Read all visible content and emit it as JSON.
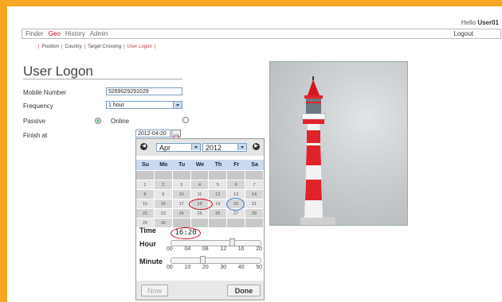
{
  "header": {
    "hello_prefix": "Hello ",
    "user": "User01"
  },
  "nav": {
    "items": [
      {
        "label": "Finder",
        "active": false
      },
      {
        "label": "Geo",
        "active": true
      },
      {
        "label": "History",
        "active": false
      },
      {
        "label": "Admin",
        "active": false
      }
    ],
    "logout": "Logout"
  },
  "subnav": {
    "items": [
      {
        "label": "Position",
        "active": false
      },
      {
        "label": "Country",
        "active": false
      },
      {
        "label": "Target Crossing",
        "active": false
      },
      {
        "label": "User Logon",
        "active": true
      }
    ],
    "sep": "|"
  },
  "form": {
    "title": "User Logon",
    "mobile_label": "Mobile Number",
    "mobile_value": "5269029291029",
    "frequency_label": "Frequency",
    "frequency_value": "1 hour",
    "mode_label": "Passive",
    "mode_option": "Online",
    "finish_label": "Finish at",
    "finish_value": "2012-04-20"
  },
  "datepicker": {
    "month": "Apr",
    "year": "2012",
    "dows": [
      "Su",
      "Mo",
      "Tu",
      "We",
      "Th",
      "Fr",
      "Sa"
    ],
    "weeks": [
      [
        "",
        "",
        "",
        "",
        "",
        "",
        ""
      ],
      [
        "1",
        "2",
        "3",
        "4",
        "5",
        "6",
        "7"
      ],
      [
        "8",
        "9",
        "10",
        "11",
        "12",
        "13",
        "14"
      ],
      [
        "15",
        "16",
        "17",
        "18",
        "19",
        "20",
        "21"
      ],
      [
        "22",
        "23",
        "24",
        "25",
        "26",
        "27",
        "28"
      ],
      [
        "29",
        "30",
        "",
        "",
        "",
        "",
        ""
      ]
    ],
    "today": "18",
    "selected": "20",
    "time_label": "Time",
    "time_value": "16:20",
    "hour_label": "Hour",
    "hour_value": 16,
    "hour_ticks": [
      "00",
      "04",
      "08",
      "12",
      "16",
      "20"
    ],
    "minute_label": "Minute",
    "minute_value": 20,
    "minute_ticks": [
      "00",
      "10",
      "20",
      "30",
      "40",
      "50"
    ],
    "now_label": "Now",
    "done_label": "Done"
  },
  "icons": {
    "prev": "arrow-left-icon",
    "next": "arrow-right-icon",
    "calendar": "calendar-icon"
  },
  "colors": {
    "frame": "#f5a623",
    "active": "#d0021b",
    "header": "#c9daf0"
  }
}
